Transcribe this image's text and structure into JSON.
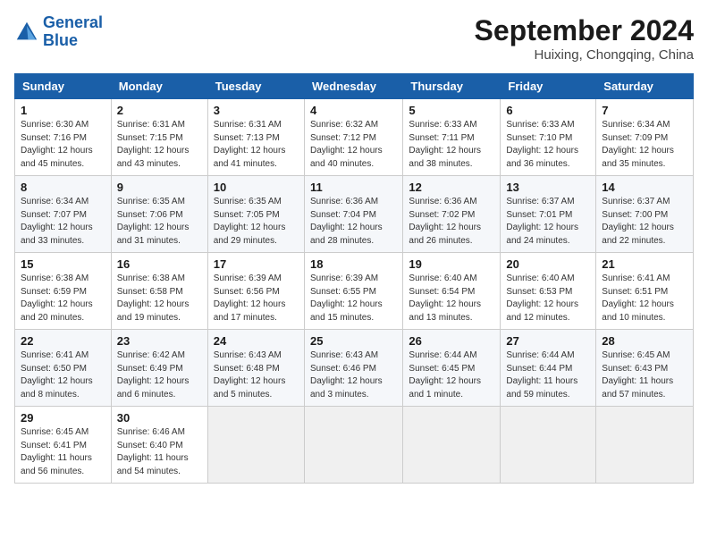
{
  "header": {
    "logo_line1": "General",
    "logo_line2": "Blue",
    "month_title": "September 2024",
    "location": "Huixing, Chongqing, China"
  },
  "weekdays": [
    "Sunday",
    "Monday",
    "Tuesday",
    "Wednesday",
    "Thursday",
    "Friday",
    "Saturday"
  ],
  "weeks": [
    [
      {
        "day": "1",
        "sunrise": "6:30 AM",
        "sunset": "7:16 PM",
        "daylight": "12 hours and 45 minutes."
      },
      {
        "day": "2",
        "sunrise": "6:31 AM",
        "sunset": "7:15 PM",
        "daylight": "12 hours and 43 minutes."
      },
      {
        "day": "3",
        "sunrise": "6:31 AM",
        "sunset": "7:13 PM",
        "daylight": "12 hours and 41 minutes."
      },
      {
        "day": "4",
        "sunrise": "6:32 AM",
        "sunset": "7:12 PM",
        "daylight": "12 hours and 40 minutes."
      },
      {
        "day": "5",
        "sunrise": "6:33 AM",
        "sunset": "7:11 PM",
        "daylight": "12 hours and 38 minutes."
      },
      {
        "day": "6",
        "sunrise": "6:33 AM",
        "sunset": "7:10 PM",
        "daylight": "12 hours and 36 minutes."
      },
      {
        "day": "7",
        "sunrise": "6:34 AM",
        "sunset": "7:09 PM",
        "daylight": "12 hours and 35 minutes."
      }
    ],
    [
      {
        "day": "8",
        "sunrise": "6:34 AM",
        "sunset": "7:07 PM",
        "daylight": "12 hours and 33 minutes."
      },
      {
        "day": "9",
        "sunrise": "6:35 AM",
        "sunset": "7:06 PM",
        "daylight": "12 hours and 31 minutes."
      },
      {
        "day": "10",
        "sunrise": "6:35 AM",
        "sunset": "7:05 PM",
        "daylight": "12 hours and 29 minutes."
      },
      {
        "day": "11",
        "sunrise": "6:36 AM",
        "sunset": "7:04 PM",
        "daylight": "12 hours and 28 minutes."
      },
      {
        "day": "12",
        "sunrise": "6:36 AM",
        "sunset": "7:02 PM",
        "daylight": "12 hours and 26 minutes."
      },
      {
        "day": "13",
        "sunrise": "6:37 AM",
        "sunset": "7:01 PM",
        "daylight": "12 hours and 24 minutes."
      },
      {
        "day": "14",
        "sunrise": "6:37 AM",
        "sunset": "7:00 PM",
        "daylight": "12 hours and 22 minutes."
      }
    ],
    [
      {
        "day": "15",
        "sunrise": "6:38 AM",
        "sunset": "6:59 PM",
        "daylight": "12 hours and 20 minutes."
      },
      {
        "day": "16",
        "sunrise": "6:38 AM",
        "sunset": "6:58 PM",
        "daylight": "12 hours and 19 minutes."
      },
      {
        "day": "17",
        "sunrise": "6:39 AM",
        "sunset": "6:56 PM",
        "daylight": "12 hours and 17 minutes."
      },
      {
        "day": "18",
        "sunrise": "6:39 AM",
        "sunset": "6:55 PM",
        "daylight": "12 hours and 15 minutes."
      },
      {
        "day": "19",
        "sunrise": "6:40 AM",
        "sunset": "6:54 PM",
        "daylight": "12 hours and 13 minutes."
      },
      {
        "day": "20",
        "sunrise": "6:40 AM",
        "sunset": "6:53 PM",
        "daylight": "12 hours and 12 minutes."
      },
      {
        "day": "21",
        "sunrise": "6:41 AM",
        "sunset": "6:51 PM",
        "daylight": "12 hours and 10 minutes."
      }
    ],
    [
      {
        "day": "22",
        "sunrise": "6:41 AM",
        "sunset": "6:50 PM",
        "daylight": "12 hours and 8 minutes."
      },
      {
        "day": "23",
        "sunrise": "6:42 AM",
        "sunset": "6:49 PM",
        "daylight": "12 hours and 6 minutes."
      },
      {
        "day": "24",
        "sunrise": "6:43 AM",
        "sunset": "6:48 PM",
        "daylight": "12 hours and 5 minutes."
      },
      {
        "day": "25",
        "sunrise": "6:43 AM",
        "sunset": "6:46 PM",
        "daylight": "12 hours and 3 minutes."
      },
      {
        "day": "26",
        "sunrise": "6:44 AM",
        "sunset": "6:45 PM",
        "daylight": "12 hours and 1 minute."
      },
      {
        "day": "27",
        "sunrise": "6:44 AM",
        "sunset": "6:44 PM",
        "daylight": "11 hours and 59 minutes."
      },
      {
        "day": "28",
        "sunrise": "6:45 AM",
        "sunset": "6:43 PM",
        "daylight": "11 hours and 57 minutes."
      }
    ],
    [
      {
        "day": "29",
        "sunrise": "6:45 AM",
        "sunset": "6:41 PM",
        "daylight": "11 hours and 56 minutes."
      },
      {
        "day": "30",
        "sunrise": "6:46 AM",
        "sunset": "6:40 PM",
        "daylight": "11 hours and 54 minutes."
      },
      null,
      null,
      null,
      null,
      null
    ]
  ]
}
